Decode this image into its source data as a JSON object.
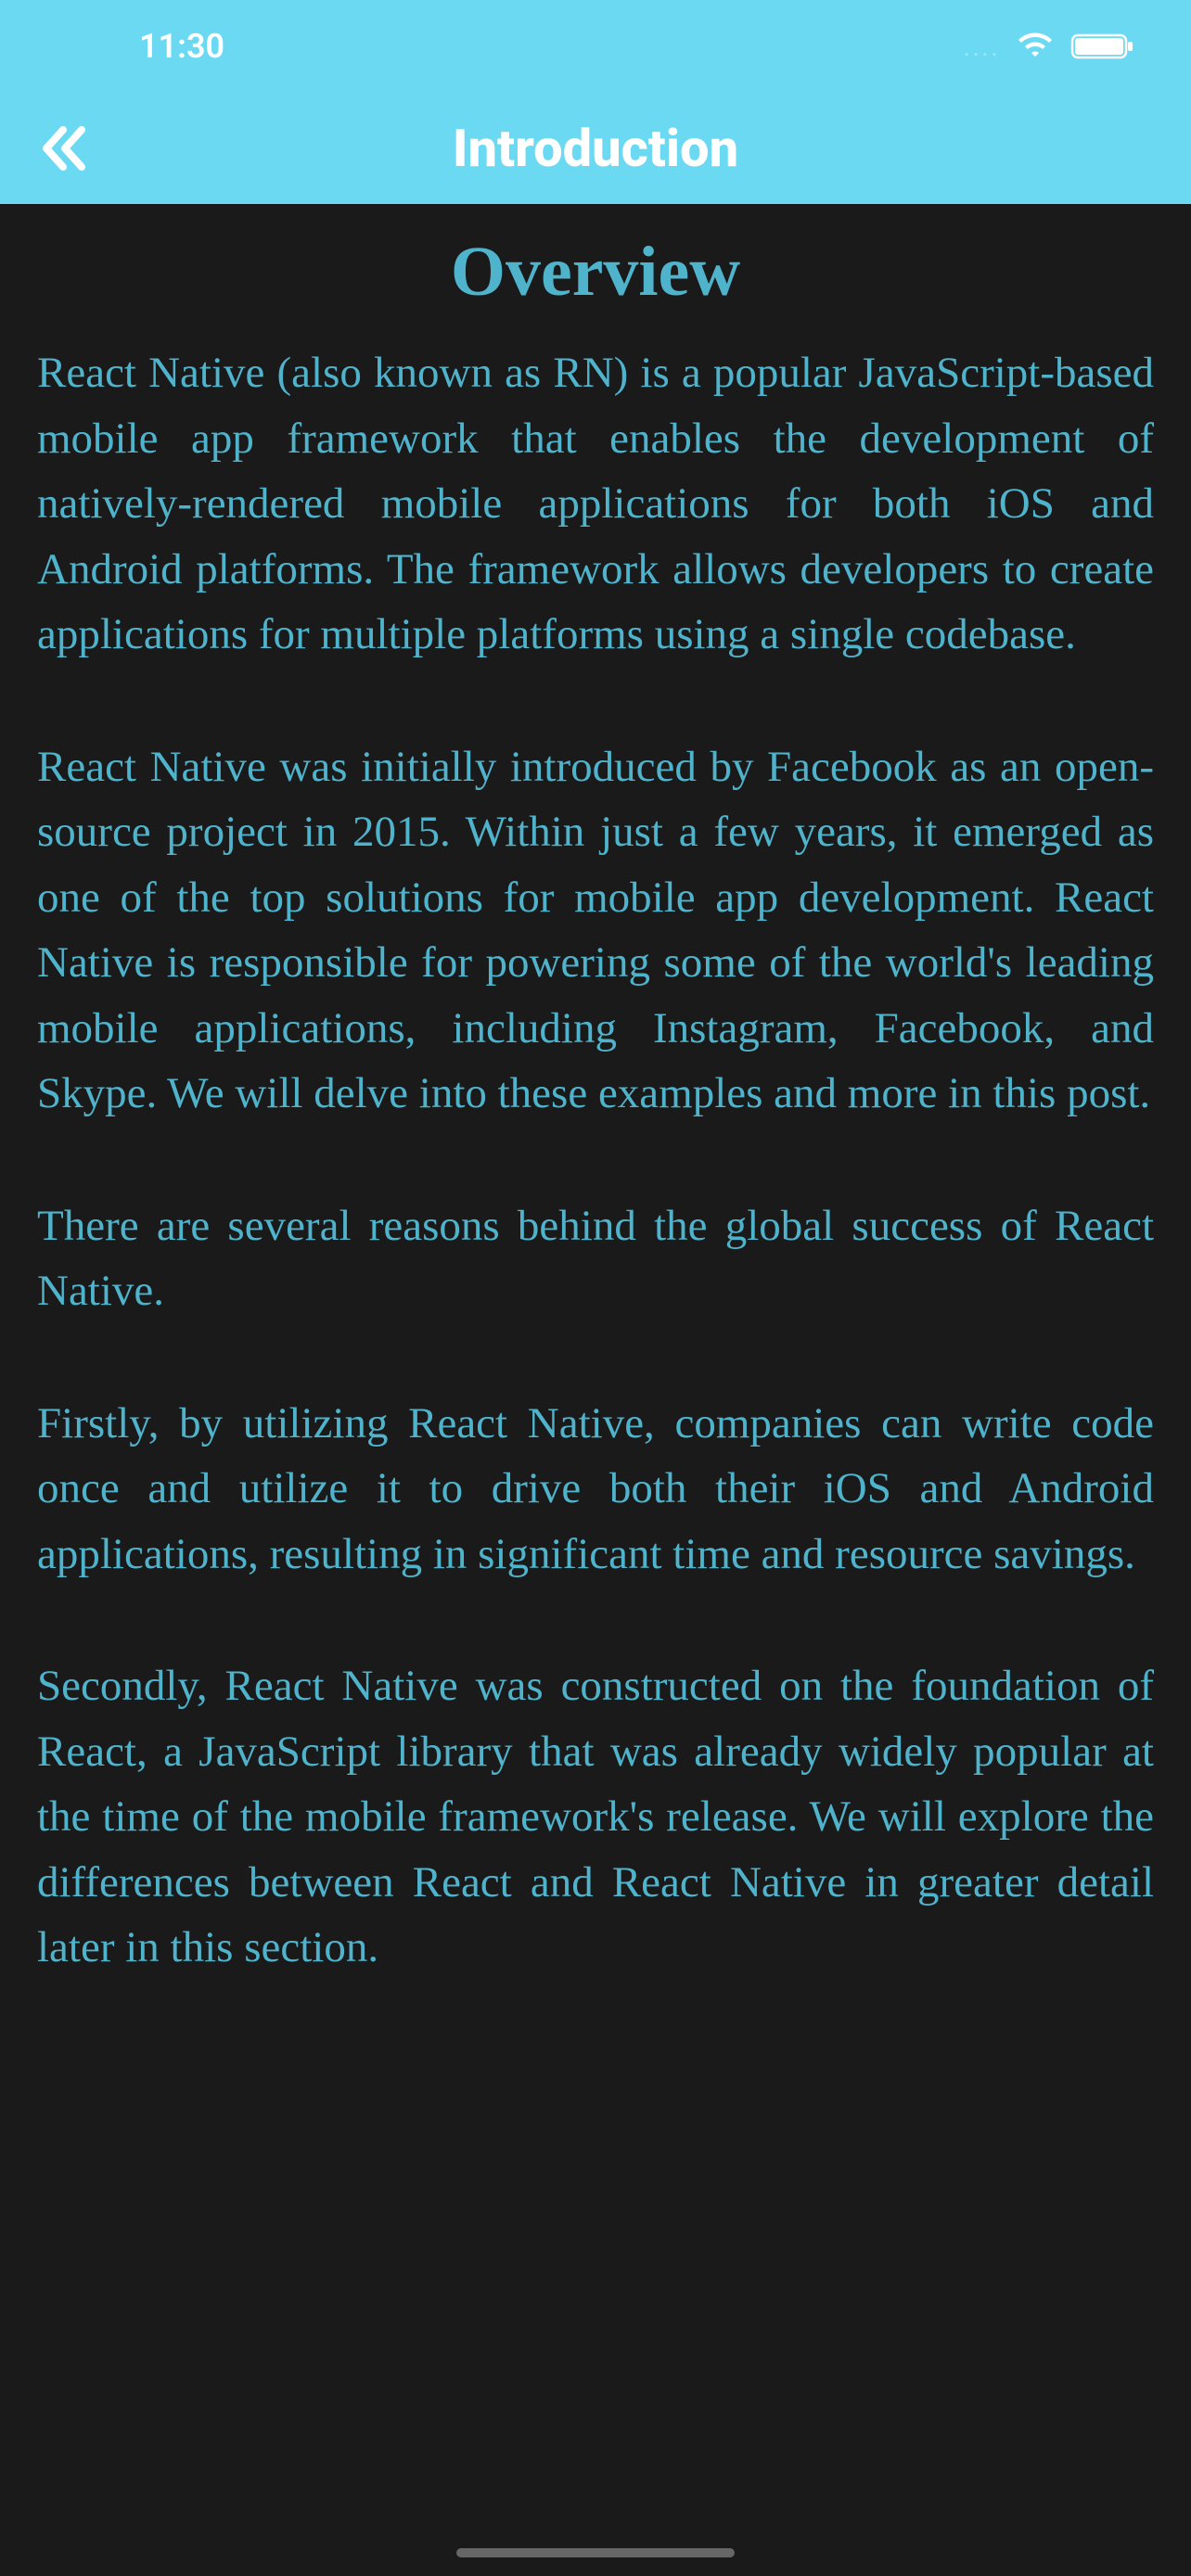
{
  "statusBar": {
    "time": "11:30",
    "dots": "...."
  },
  "navBar": {
    "title": "Introduction"
  },
  "content": {
    "heading": "Overview",
    "paragraphs": [
      "React Native (also known as RN) is a popular JavaScript-based mobile app framework that enables the development of natively-rendered mobile applications for both iOS and Android platforms. The framework allows developers to create applications for multiple platforms using a single codebase.",
      "React Native was initially introduced by Facebook as an open-source project in 2015. Within just a few years, it emerged as one of the top solutions for mobile app development. React Native is responsible for powering some of the world's leading mobile applications, including Instagram, Facebook, and Skype. We will delve into these examples and more in this post.",
      "There are several reasons behind the global success of React Native.",
      "Firstly, by utilizing React Native, companies can write code once and utilize it to drive both their iOS and Android applications, resulting in significant time and resource savings.",
      "Secondly, React Native was constructed on the foundation of React, a JavaScript library that was already widely popular at the time of the mobile framework's release. We will explore the differences between React and React Native in greater detail later in this section."
    ]
  }
}
